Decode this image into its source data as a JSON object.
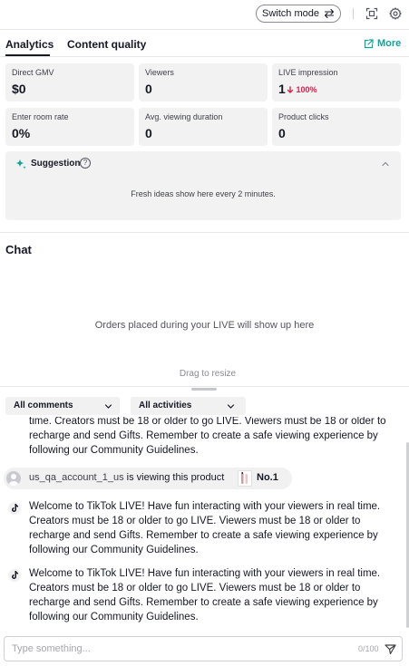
{
  "header": {
    "switch_mode_label": "Switch mode"
  },
  "tabs": [
    {
      "label": "Analytics",
      "active": true
    },
    {
      "label": "Content quality",
      "active": false
    }
  ],
  "more_label": "More",
  "metrics": [
    {
      "label": "Direct GMV",
      "value": "$0"
    },
    {
      "label": "Viewers",
      "value": "0"
    },
    {
      "label": "LIVE impression",
      "value": "1",
      "delta": "100%",
      "trend": "down"
    },
    {
      "label": "Enter room rate",
      "value": "0%"
    },
    {
      "label": "Avg. viewing duration",
      "value": "0"
    },
    {
      "label": "Product clicks",
      "value": "0"
    }
  ],
  "suggestion": {
    "title": "Suggestion",
    "help": "?",
    "text": "Fresh ideas show here every 2 minutes."
  },
  "chat": {
    "title": "Chat",
    "orders_empty_text": "Orders placed during your LIVE will show up here",
    "drag_text": "Drag to resize",
    "comments_filter": "All comments",
    "activities_filter": "All activities",
    "partial_message": "time. Creators must be 18 or older to go LIVE. Viewers must be 18 or older to recharge and send Gifts. Remember to create a safe viewing experience by following our Community Guidelines.",
    "viewing": {
      "username": "us_qa_account_1_us",
      "text": " is viewing this product",
      "rank": "No.1"
    },
    "messages": [
      "Welcome to TikTok LIVE! Have fun interacting with your viewers in real time. Creators must be 18 or older to go LIVE. Viewers must be 18 or older to recharge and send Gifts. Remember to create a safe viewing experience by following our Community Guidelines.",
      "Welcome to TikTok LIVE! Have fun interacting with your viewers in real time. Creators must be 18 or older to go LIVE. Viewers must be 18 or older to recharge and send Gifts. Remember to create a safe viewing experience by following our Community Guidelines."
    ],
    "input_placeholder": "Type something...",
    "char_count": "0/100"
  },
  "colors": {
    "accent": "#0fa39b",
    "negative": "#d4224d",
    "card_bg": "#f2f2f3"
  }
}
